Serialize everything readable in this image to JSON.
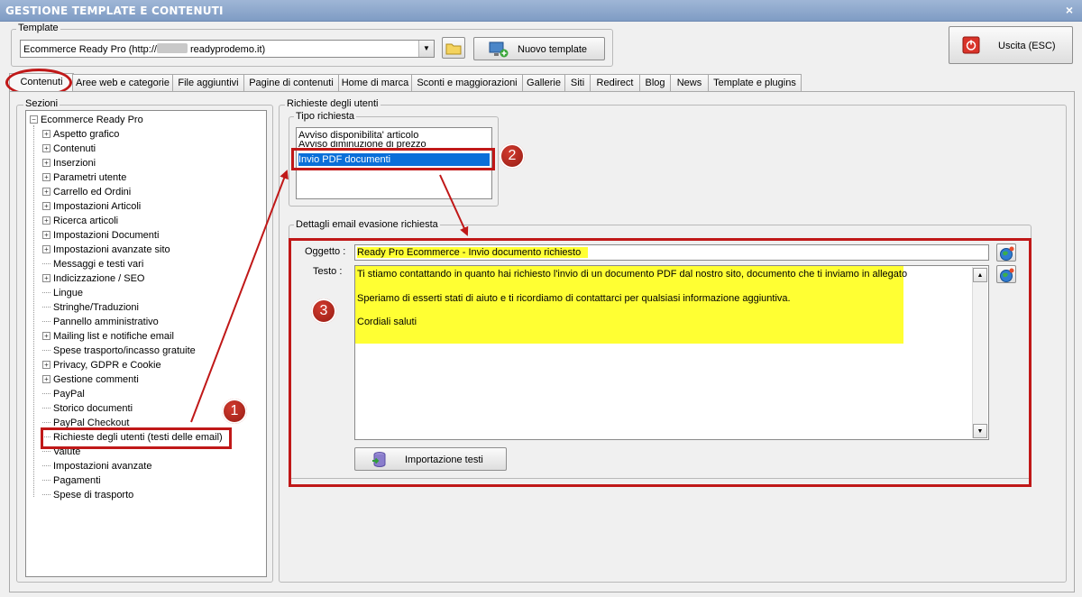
{
  "window": {
    "title": "GESTIONE TEMPLATE E CONTENUTI",
    "close_glyph": "×"
  },
  "template_group": {
    "label": "Template",
    "selected_prefix": "Ecommerce Ready Pro (http://",
    "selected_suffix": "readyprodemo.it)",
    "new_button": "Nuovo template"
  },
  "exit_button": "Uscita (ESC)",
  "tabs": [
    "Contenuti",
    "Aree web e categorie",
    "File aggiuntivi",
    "Pagine di contenuti",
    "Home di marca",
    "Sconti e maggiorazioni",
    "Gallerie",
    "Siti",
    "Redirect",
    "Blog",
    "News",
    "Template e plugins"
  ],
  "sections": {
    "label": "Sezioni",
    "root": "Ecommerce Ready Pro",
    "items": [
      "Aspetto grafico",
      "Contenuti",
      "Inserzioni",
      "Parametri utente",
      "Carrello ed Ordini",
      "Impostazioni Articoli",
      "Ricerca articoli",
      "Impostazioni Documenti",
      "Impostazioni avanzate sito",
      "Messaggi e testi vari",
      "Indicizzazione / SEO",
      "Lingue",
      "Stringhe/Traduzioni",
      "Pannello amministrativo",
      "Mailing list e notifiche email",
      "Spese trasporto/incasso gratuite",
      "Privacy, GDPR e Cookie",
      "Gestione commenti",
      "PayPal",
      "Storico documenti",
      "PayPal Checkout",
      "Richieste degli utenti (testi delle email)",
      "Valute",
      "Impostazioni avanzate",
      "Pagamenti",
      "Spese di trasporto"
    ]
  },
  "requests": {
    "label": "Richieste degli utenti",
    "type_label": "Tipo richiesta",
    "types": [
      "Avviso disponibilita' articolo",
      "Avviso diminuzione di prezzo",
      "Invio PDF documenti"
    ],
    "details_label": "Dettagli email evasione richiesta",
    "subject_label": "Oggetto :",
    "subject_value": "Ready Pro Ecommerce - Invio documento richiesto",
    "text_label": "Testo :",
    "text_lines": [
      "Ti stiamo contattando in quanto hai richiesto l'invio di un documento PDF dal nostro sito, documento che ti inviamo in allegato",
      "Speriamo di esserti stati di aiuto e ti ricordiamo di contattarci per qualsiasi informazione aggiuntiva.",
      "Cordiali saluti"
    ],
    "import_button": "Importazione testi"
  },
  "badges": [
    "1",
    "2",
    "3"
  ],
  "colors": {
    "annotation_red": "#c01818",
    "highlight_yellow": "#ffff33",
    "selection_blue": "#0a6fd9"
  }
}
